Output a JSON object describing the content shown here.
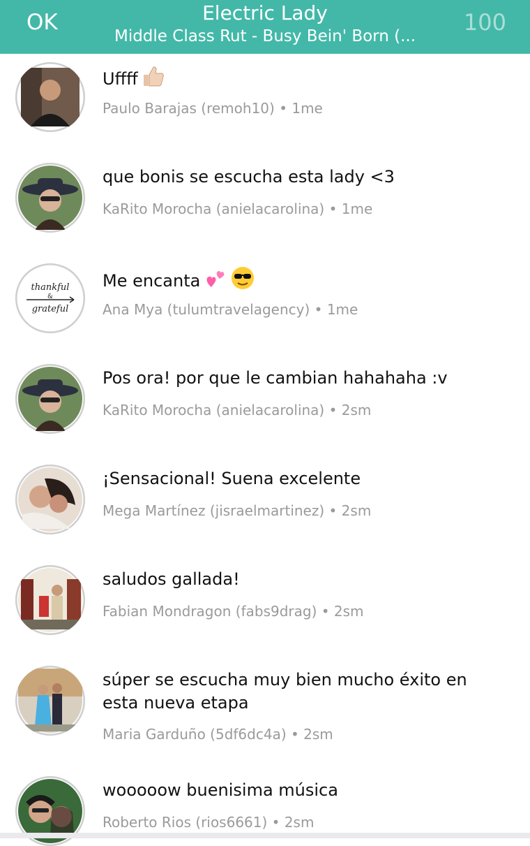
{
  "navbar": {
    "ok_label": "OK",
    "title": "Electric Lady",
    "subtitle": "Middle Class Rut - Busy Bein' Born (...",
    "count": "100"
  },
  "comments": [
    {
      "text": "Uffff",
      "emoji": "thumbs-up",
      "author": "Paulo Barajas (remoh10)",
      "time": "1me"
    },
    {
      "text": "que bonis se escucha esta lady <3",
      "author": "KaRito Morocha (anielacarolina)",
      "time": "1me"
    },
    {
      "text": "Me encanta",
      "emoji": "two-hearts, sunglasses-face",
      "author": "Ana Mya (tulumtravelagency)",
      "time": "1me"
    },
    {
      "text": "Pos ora! por que le cambian hahahaha :v",
      "author": "KaRito Morocha (anielacarolina)",
      "time": "2sm"
    },
    {
      "text": "¡Sensacional! Suena excelente",
      "author": "Mega Martínez (jisraelmartinez)",
      "time": "2sm"
    },
    {
      "text": "saludos gallada!",
      "author": "Fabian Mondragon (fabs9drag)",
      "time": "2sm"
    },
    {
      "text": "súper se escucha muy bien mucho éxito en esta nueva etapa",
      "author": "Maria Garduño (5df6dc4a)",
      "time": "2sm"
    },
    {
      "text": "wooooow buenisima música",
      "author": "Roberto Rios (rios6661)",
      "time": "2sm"
    }
  ],
  "avatar_art": {
    "avatar3_line1": "thankful",
    "avatar3_amp": "&",
    "avatar3_line2": "grateful"
  },
  "separator": "•"
}
